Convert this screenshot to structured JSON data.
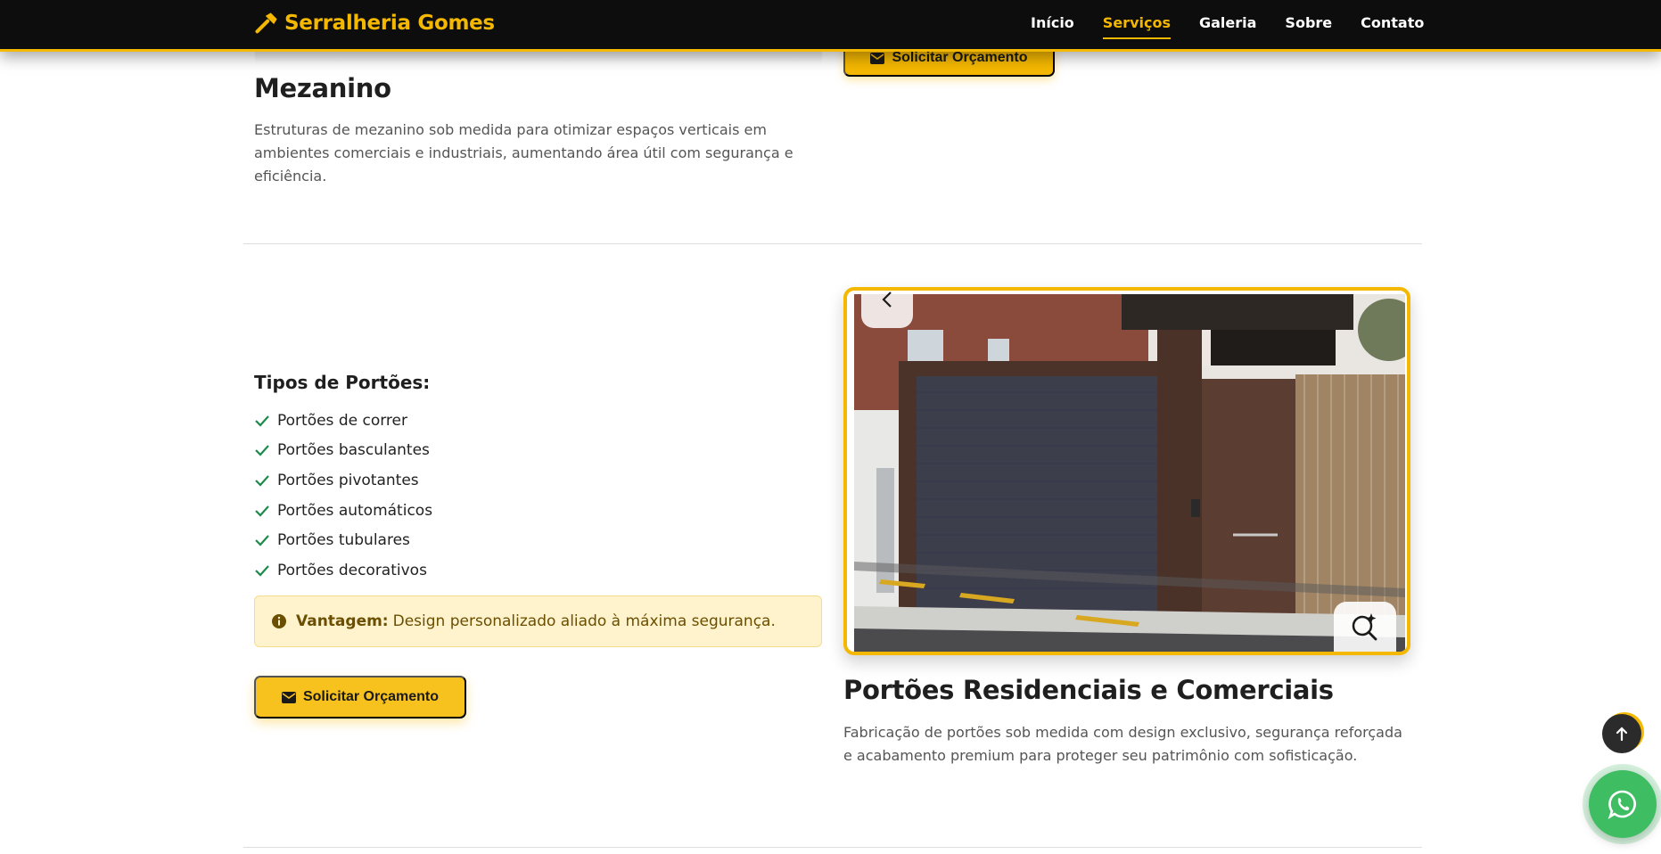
{
  "nav": {
    "brand": "Serralheria Gomes",
    "brand_icon": "hammer-icon",
    "links": [
      {
        "label": "Início"
      },
      {
        "label": "Serviços",
        "active": true
      },
      {
        "label": "Galeria"
      },
      {
        "label": "Sobre"
      },
      {
        "label": "Contato"
      }
    ]
  },
  "mezanino": {
    "quote_button": "Solicitar Orçamento",
    "title": "Mezanino",
    "description": "Estruturas de mezanino sob medida para otimizar espaços verticais em ambientes comerciais e industriais, aumentando área útil com segurança e eficiência."
  },
  "portoes": {
    "types_title": "Tipos de Portões:",
    "types": [
      "Portões de correr",
      "Portões basculantes",
      "Portões pivotantes",
      "Portões automáticos",
      "Portões tubulares",
      "Portões decorativos"
    ],
    "advantage_label": "Vantagem:",
    "advantage_text": "Design personalizado aliado à máxima segurança.",
    "quote_button": "Solicitar Orçamento",
    "title": "Portões Residenciais e Comerciais",
    "description": "Fabricação de portões sob medida com design exclusivo, segurança reforçada e acabamento premium para proteger seu patrimônio com sofisticação."
  },
  "colors": {
    "accent": "#f5b800",
    "navbar_bg": "#0d0d0d",
    "check": "#1e8a4c",
    "whatsapp": "#3ebd63"
  },
  "icons": {
    "back_to_top": "arrow-up-icon",
    "whatsapp": "whatsapp-icon",
    "zoom": "zoom-sparkle-icon",
    "prev": "chevron-left-icon"
  }
}
